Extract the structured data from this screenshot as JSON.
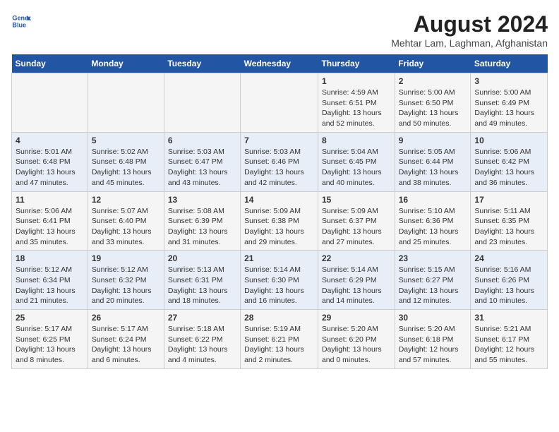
{
  "header": {
    "logo_line1": "General",
    "logo_line2": "Blue",
    "title": "August 2024",
    "subtitle": "Mehtar Lam, Laghman, Afghanistan"
  },
  "days_of_week": [
    "Sunday",
    "Monday",
    "Tuesday",
    "Wednesday",
    "Thursday",
    "Friday",
    "Saturday"
  ],
  "weeks": [
    [
      {
        "day": "",
        "text": ""
      },
      {
        "day": "",
        "text": ""
      },
      {
        "day": "",
        "text": ""
      },
      {
        "day": "",
        "text": ""
      },
      {
        "day": "1",
        "text": "Sunrise: 4:59 AM\nSunset: 6:51 PM\nDaylight: 13 hours\nand 52 minutes."
      },
      {
        "day": "2",
        "text": "Sunrise: 5:00 AM\nSunset: 6:50 PM\nDaylight: 13 hours\nand 50 minutes."
      },
      {
        "day": "3",
        "text": "Sunrise: 5:00 AM\nSunset: 6:49 PM\nDaylight: 13 hours\nand 49 minutes."
      }
    ],
    [
      {
        "day": "4",
        "text": "Sunrise: 5:01 AM\nSunset: 6:48 PM\nDaylight: 13 hours\nand 47 minutes."
      },
      {
        "day": "5",
        "text": "Sunrise: 5:02 AM\nSunset: 6:48 PM\nDaylight: 13 hours\nand 45 minutes."
      },
      {
        "day": "6",
        "text": "Sunrise: 5:03 AM\nSunset: 6:47 PM\nDaylight: 13 hours\nand 43 minutes."
      },
      {
        "day": "7",
        "text": "Sunrise: 5:03 AM\nSunset: 6:46 PM\nDaylight: 13 hours\nand 42 minutes."
      },
      {
        "day": "8",
        "text": "Sunrise: 5:04 AM\nSunset: 6:45 PM\nDaylight: 13 hours\nand 40 minutes."
      },
      {
        "day": "9",
        "text": "Sunrise: 5:05 AM\nSunset: 6:44 PM\nDaylight: 13 hours\nand 38 minutes."
      },
      {
        "day": "10",
        "text": "Sunrise: 5:06 AM\nSunset: 6:42 PM\nDaylight: 13 hours\nand 36 minutes."
      }
    ],
    [
      {
        "day": "11",
        "text": "Sunrise: 5:06 AM\nSunset: 6:41 PM\nDaylight: 13 hours\nand 35 minutes."
      },
      {
        "day": "12",
        "text": "Sunrise: 5:07 AM\nSunset: 6:40 PM\nDaylight: 13 hours\nand 33 minutes."
      },
      {
        "day": "13",
        "text": "Sunrise: 5:08 AM\nSunset: 6:39 PM\nDaylight: 13 hours\nand 31 minutes."
      },
      {
        "day": "14",
        "text": "Sunrise: 5:09 AM\nSunset: 6:38 PM\nDaylight: 13 hours\nand 29 minutes."
      },
      {
        "day": "15",
        "text": "Sunrise: 5:09 AM\nSunset: 6:37 PM\nDaylight: 13 hours\nand 27 minutes."
      },
      {
        "day": "16",
        "text": "Sunrise: 5:10 AM\nSunset: 6:36 PM\nDaylight: 13 hours\nand 25 minutes."
      },
      {
        "day": "17",
        "text": "Sunrise: 5:11 AM\nSunset: 6:35 PM\nDaylight: 13 hours\nand 23 minutes."
      }
    ],
    [
      {
        "day": "18",
        "text": "Sunrise: 5:12 AM\nSunset: 6:34 PM\nDaylight: 13 hours\nand 21 minutes."
      },
      {
        "day": "19",
        "text": "Sunrise: 5:12 AM\nSunset: 6:32 PM\nDaylight: 13 hours\nand 20 minutes."
      },
      {
        "day": "20",
        "text": "Sunrise: 5:13 AM\nSunset: 6:31 PM\nDaylight: 13 hours\nand 18 minutes."
      },
      {
        "day": "21",
        "text": "Sunrise: 5:14 AM\nSunset: 6:30 PM\nDaylight: 13 hours\nand 16 minutes."
      },
      {
        "day": "22",
        "text": "Sunrise: 5:14 AM\nSunset: 6:29 PM\nDaylight: 13 hours\nand 14 minutes."
      },
      {
        "day": "23",
        "text": "Sunrise: 5:15 AM\nSunset: 6:27 PM\nDaylight: 13 hours\nand 12 minutes."
      },
      {
        "day": "24",
        "text": "Sunrise: 5:16 AM\nSunset: 6:26 PM\nDaylight: 13 hours\nand 10 minutes."
      }
    ],
    [
      {
        "day": "25",
        "text": "Sunrise: 5:17 AM\nSunset: 6:25 PM\nDaylight: 13 hours\nand 8 minutes."
      },
      {
        "day": "26",
        "text": "Sunrise: 5:17 AM\nSunset: 6:24 PM\nDaylight: 13 hours\nand 6 minutes."
      },
      {
        "day": "27",
        "text": "Sunrise: 5:18 AM\nSunset: 6:22 PM\nDaylight: 13 hours\nand 4 minutes."
      },
      {
        "day": "28",
        "text": "Sunrise: 5:19 AM\nSunset: 6:21 PM\nDaylight: 13 hours\nand 2 minutes."
      },
      {
        "day": "29",
        "text": "Sunrise: 5:20 AM\nSunset: 6:20 PM\nDaylight: 13 hours\nand 0 minutes."
      },
      {
        "day": "30",
        "text": "Sunrise: 5:20 AM\nSunset: 6:18 PM\nDaylight: 12 hours\nand 57 minutes."
      },
      {
        "day": "31",
        "text": "Sunrise: 5:21 AM\nSunset: 6:17 PM\nDaylight: 12 hours\nand 55 minutes."
      }
    ]
  ]
}
